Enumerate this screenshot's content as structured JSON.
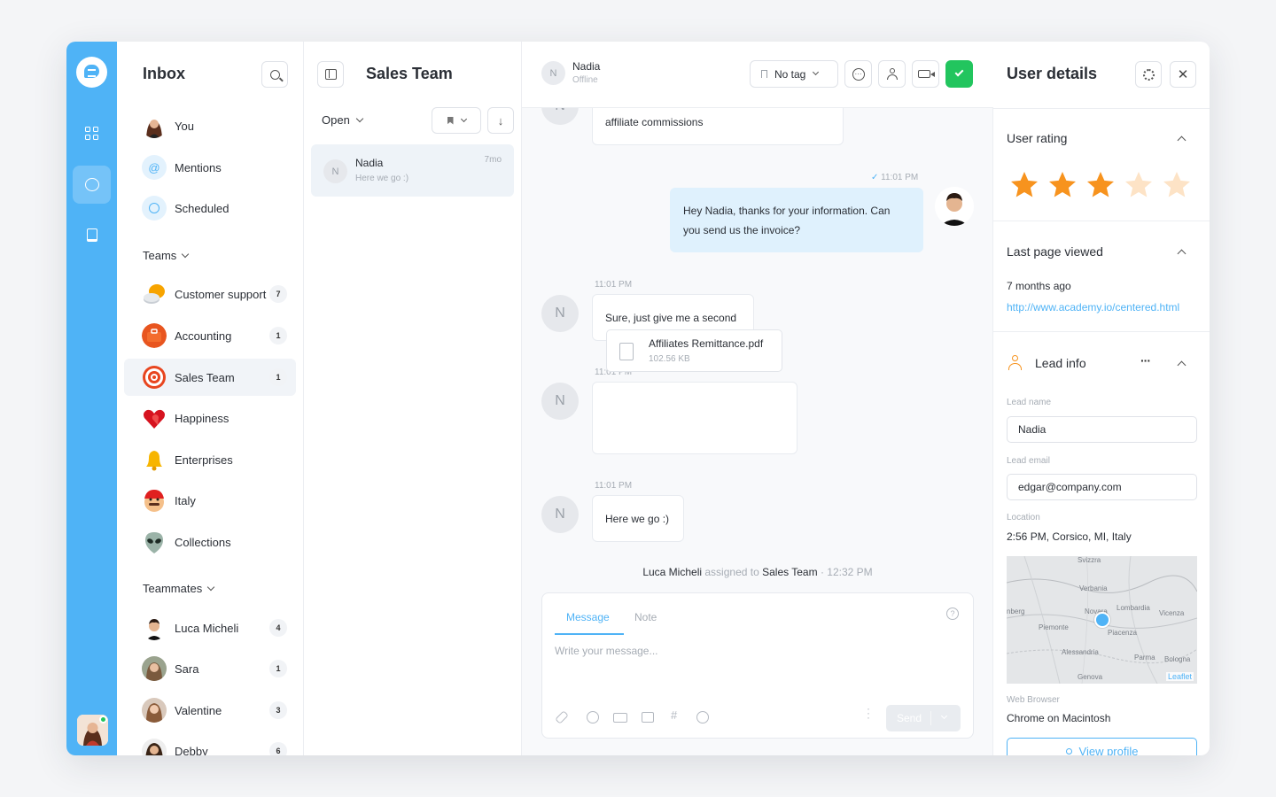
{
  "inbox": {
    "title": "Inbox",
    "nav": [
      {
        "label": "You"
      },
      {
        "label": "Mentions"
      },
      {
        "label": "Scheduled"
      }
    ],
    "teams_heading": "Teams",
    "teams": [
      {
        "label": "Customer support",
        "count": "7"
      },
      {
        "label": "Accounting",
        "count": "1"
      },
      {
        "label": "Sales Team",
        "count": "1"
      },
      {
        "label": "Happiness"
      },
      {
        "label": "Enterprises"
      },
      {
        "label": "Italy"
      },
      {
        "label": "Collections"
      }
    ],
    "teammates_heading": "Teammates",
    "teammates": [
      {
        "label": "Luca Micheli",
        "count": "4"
      },
      {
        "label": "Sara",
        "count": "1"
      },
      {
        "label": "Valentine",
        "count": "3"
      },
      {
        "label": "Debby",
        "count": "6"
      }
    ]
  },
  "conversations": {
    "title": "Sales Team",
    "filter": "Open",
    "items": [
      {
        "initial": "N",
        "name": "Nadia",
        "preview": "Here we go :)",
        "time": "7mo"
      }
    ]
  },
  "chat": {
    "contact_initial": "N",
    "contact_name": "Nadia",
    "contact_status": "Offline",
    "tag_label": "No tag",
    "messages": {
      "m0_text": "affiliate commissions",
      "m1_time": "11:01 PM",
      "m1_text": "Hey Nadia, thanks for your information. Can you send us the invoice?",
      "m2_time": "11:01 PM",
      "m2_text": "Sure, just give me a second",
      "m3_time": "11:01 PM",
      "m3_file_name": "Affiliates Remittance.pdf",
      "m3_file_size": "102.56 KB",
      "m4_time": "11:01 PM",
      "m4_text": "Here we go :)"
    },
    "system": {
      "actor": "Luca Micheli",
      "verb": "assigned to",
      "target": "Sales Team",
      "time": "12:32 PM"
    },
    "composer": {
      "tab_message": "Message",
      "tab_note": "Note",
      "placeholder": "Write your message...",
      "send_label": "Send"
    }
  },
  "details": {
    "title": "User details",
    "rating_title": "User rating",
    "rating": 3,
    "rating_max": 5,
    "last_page_title": "Last page viewed",
    "last_page_when": "7 months ago",
    "last_page_url": "http://www.academy.io/centered.html",
    "lead_title": "Lead info",
    "lead_name_label": "Lead name",
    "lead_name": "Nadia",
    "lead_email_label": "Lead email",
    "lead_email": "edgar@company.com",
    "location_label": "Location",
    "location": "2:56 PM, Corsico, MI, Italy",
    "map_places": [
      "Svizzra",
      "Verbania",
      "Novara",
      "Lombardia",
      "Vicenza",
      "Piemonte",
      "Piacenza",
      "Alessandria",
      "Parma",
      "Bologna",
      "Genova",
      "nberg"
    ],
    "map_attribution": "Leaflet",
    "browser_label": "Web Browser",
    "browser": "Chrome on Macintosh",
    "view_profile": "View profile"
  },
  "colors": {
    "accent": "#4fb3f6",
    "success": "#22c55e",
    "star": "#f7931e"
  }
}
